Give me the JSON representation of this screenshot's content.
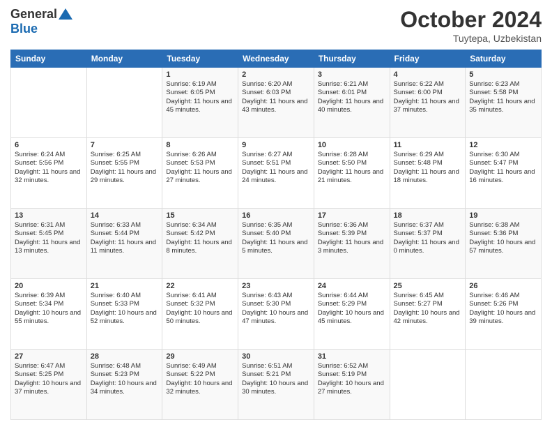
{
  "header": {
    "logo_general": "General",
    "logo_blue": "Blue",
    "title": "October 2024",
    "location": "Tuytepa, Uzbekistan"
  },
  "weekdays": [
    "Sunday",
    "Monday",
    "Tuesday",
    "Wednesday",
    "Thursday",
    "Friday",
    "Saturday"
  ],
  "weeks": [
    [
      {
        "day": "",
        "sunrise": "",
        "sunset": "",
        "daylight": ""
      },
      {
        "day": "",
        "sunrise": "",
        "sunset": "",
        "daylight": ""
      },
      {
        "day": "1",
        "sunrise": "Sunrise: 6:19 AM",
        "sunset": "Sunset: 6:05 PM",
        "daylight": "Daylight: 11 hours and 45 minutes."
      },
      {
        "day": "2",
        "sunrise": "Sunrise: 6:20 AM",
        "sunset": "Sunset: 6:03 PM",
        "daylight": "Daylight: 11 hours and 43 minutes."
      },
      {
        "day": "3",
        "sunrise": "Sunrise: 6:21 AM",
        "sunset": "Sunset: 6:01 PM",
        "daylight": "Daylight: 11 hours and 40 minutes."
      },
      {
        "day": "4",
        "sunrise": "Sunrise: 6:22 AM",
        "sunset": "Sunset: 6:00 PM",
        "daylight": "Daylight: 11 hours and 37 minutes."
      },
      {
        "day": "5",
        "sunrise": "Sunrise: 6:23 AM",
        "sunset": "Sunset: 5:58 PM",
        "daylight": "Daylight: 11 hours and 35 minutes."
      }
    ],
    [
      {
        "day": "6",
        "sunrise": "Sunrise: 6:24 AM",
        "sunset": "Sunset: 5:56 PM",
        "daylight": "Daylight: 11 hours and 32 minutes."
      },
      {
        "day": "7",
        "sunrise": "Sunrise: 6:25 AM",
        "sunset": "Sunset: 5:55 PM",
        "daylight": "Daylight: 11 hours and 29 minutes."
      },
      {
        "day": "8",
        "sunrise": "Sunrise: 6:26 AM",
        "sunset": "Sunset: 5:53 PM",
        "daylight": "Daylight: 11 hours and 27 minutes."
      },
      {
        "day": "9",
        "sunrise": "Sunrise: 6:27 AM",
        "sunset": "Sunset: 5:51 PM",
        "daylight": "Daylight: 11 hours and 24 minutes."
      },
      {
        "day": "10",
        "sunrise": "Sunrise: 6:28 AM",
        "sunset": "Sunset: 5:50 PM",
        "daylight": "Daylight: 11 hours and 21 minutes."
      },
      {
        "day": "11",
        "sunrise": "Sunrise: 6:29 AM",
        "sunset": "Sunset: 5:48 PM",
        "daylight": "Daylight: 11 hours and 18 minutes."
      },
      {
        "day": "12",
        "sunrise": "Sunrise: 6:30 AM",
        "sunset": "Sunset: 5:47 PM",
        "daylight": "Daylight: 11 hours and 16 minutes."
      }
    ],
    [
      {
        "day": "13",
        "sunrise": "Sunrise: 6:31 AM",
        "sunset": "Sunset: 5:45 PM",
        "daylight": "Daylight: 11 hours and 13 minutes."
      },
      {
        "day": "14",
        "sunrise": "Sunrise: 6:33 AM",
        "sunset": "Sunset: 5:44 PM",
        "daylight": "Daylight: 11 hours and 11 minutes."
      },
      {
        "day": "15",
        "sunrise": "Sunrise: 6:34 AM",
        "sunset": "Sunset: 5:42 PM",
        "daylight": "Daylight: 11 hours and 8 minutes."
      },
      {
        "day": "16",
        "sunrise": "Sunrise: 6:35 AM",
        "sunset": "Sunset: 5:40 PM",
        "daylight": "Daylight: 11 hours and 5 minutes."
      },
      {
        "day": "17",
        "sunrise": "Sunrise: 6:36 AM",
        "sunset": "Sunset: 5:39 PM",
        "daylight": "Daylight: 11 hours and 3 minutes."
      },
      {
        "day": "18",
        "sunrise": "Sunrise: 6:37 AM",
        "sunset": "Sunset: 5:37 PM",
        "daylight": "Daylight: 11 hours and 0 minutes."
      },
      {
        "day": "19",
        "sunrise": "Sunrise: 6:38 AM",
        "sunset": "Sunset: 5:36 PM",
        "daylight": "Daylight: 10 hours and 57 minutes."
      }
    ],
    [
      {
        "day": "20",
        "sunrise": "Sunrise: 6:39 AM",
        "sunset": "Sunset: 5:34 PM",
        "daylight": "Daylight: 10 hours and 55 minutes."
      },
      {
        "day": "21",
        "sunrise": "Sunrise: 6:40 AM",
        "sunset": "Sunset: 5:33 PM",
        "daylight": "Daylight: 10 hours and 52 minutes."
      },
      {
        "day": "22",
        "sunrise": "Sunrise: 6:41 AM",
        "sunset": "Sunset: 5:32 PM",
        "daylight": "Daylight: 10 hours and 50 minutes."
      },
      {
        "day": "23",
        "sunrise": "Sunrise: 6:43 AM",
        "sunset": "Sunset: 5:30 PM",
        "daylight": "Daylight: 10 hours and 47 minutes."
      },
      {
        "day": "24",
        "sunrise": "Sunrise: 6:44 AM",
        "sunset": "Sunset: 5:29 PM",
        "daylight": "Daylight: 10 hours and 45 minutes."
      },
      {
        "day": "25",
        "sunrise": "Sunrise: 6:45 AM",
        "sunset": "Sunset: 5:27 PM",
        "daylight": "Daylight: 10 hours and 42 minutes."
      },
      {
        "day": "26",
        "sunrise": "Sunrise: 6:46 AM",
        "sunset": "Sunset: 5:26 PM",
        "daylight": "Daylight: 10 hours and 39 minutes."
      }
    ],
    [
      {
        "day": "27",
        "sunrise": "Sunrise: 6:47 AM",
        "sunset": "Sunset: 5:25 PM",
        "daylight": "Daylight: 10 hours and 37 minutes."
      },
      {
        "day": "28",
        "sunrise": "Sunrise: 6:48 AM",
        "sunset": "Sunset: 5:23 PM",
        "daylight": "Daylight: 10 hours and 34 minutes."
      },
      {
        "day": "29",
        "sunrise": "Sunrise: 6:49 AM",
        "sunset": "Sunset: 5:22 PM",
        "daylight": "Daylight: 10 hours and 32 minutes."
      },
      {
        "day": "30",
        "sunrise": "Sunrise: 6:51 AM",
        "sunset": "Sunset: 5:21 PM",
        "daylight": "Daylight: 10 hours and 30 minutes."
      },
      {
        "day": "31",
        "sunrise": "Sunrise: 6:52 AM",
        "sunset": "Sunset: 5:19 PM",
        "daylight": "Daylight: 10 hours and 27 minutes."
      },
      {
        "day": "",
        "sunrise": "",
        "sunset": "",
        "daylight": ""
      },
      {
        "day": "",
        "sunrise": "",
        "sunset": "",
        "daylight": ""
      }
    ]
  ]
}
